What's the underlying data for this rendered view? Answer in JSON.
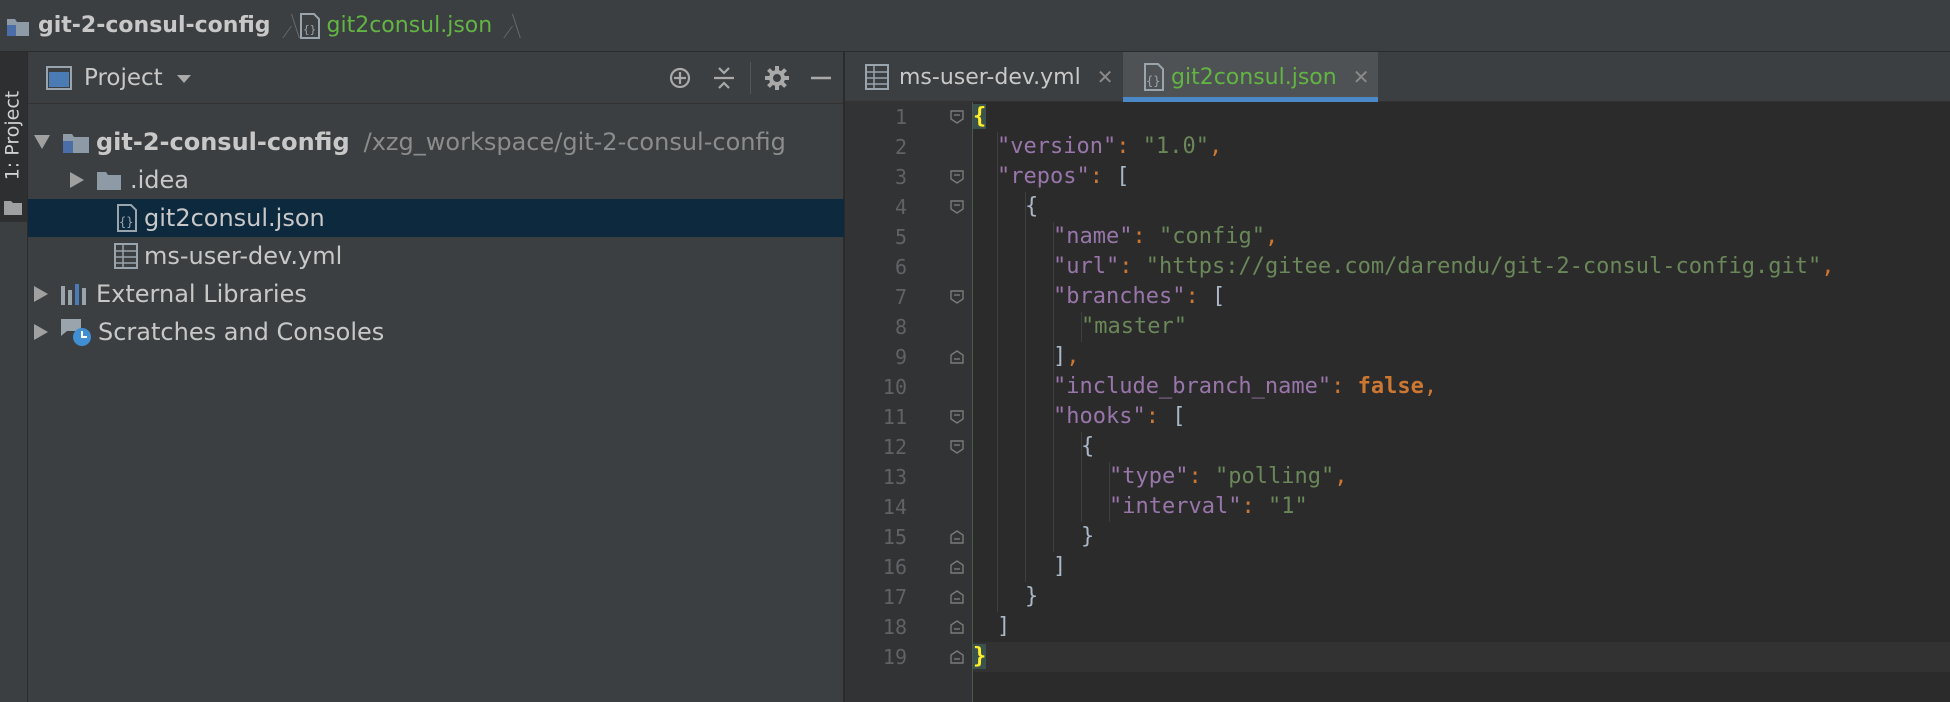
{
  "breadcrumb": {
    "project": "git-2-consul-config",
    "file": "git2consul.json"
  },
  "tool_stripe": {
    "label": "1: Project"
  },
  "project_panel": {
    "title": "Project",
    "tree": [
      {
        "label": "git-2-consul-config",
        "path": "/xzg_workspace/git-2-consul-config",
        "expanded": true
      },
      {
        "label": ".idea",
        "expanded": false
      },
      {
        "label": "git2consul.json",
        "selected": true
      },
      {
        "label": "ms-user-dev.yml"
      },
      {
        "label": "External Libraries",
        "expanded": false
      },
      {
        "label": "Scratches and Consoles",
        "expanded": false
      }
    ]
  },
  "tabs": [
    {
      "label": "ms-user-dev.yml",
      "active": false
    },
    {
      "label": "git2consul.json",
      "active": true
    }
  ],
  "line_numbers": [
    "1",
    "2",
    "3",
    "4",
    "5",
    "6",
    "7",
    "8",
    "9",
    "10",
    "11",
    "12",
    "13",
    "14",
    "15",
    "16",
    "17",
    "18",
    "19"
  ],
  "code": {
    "l2": {
      "key": "\"version\"",
      "value": "\"1.0\""
    },
    "l3": {
      "key": "\"repos\""
    },
    "l5": {
      "key": "\"name\"",
      "value": "\"config\""
    },
    "l6": {
      "key": "\"url\"",
      "value": "\"https://gitee.com/darendu/git-2-consul-config.git\""
    },
    "l7": {
      "key": "\"branches\""
    },
    "l8": {
      "value": "\"master\""
    },
    "l10": {
      "key": "\"include_branch_name\"",
      "value": "false"
    },
    "l11": {
      "key": "\"hooks\""
    },
    "l13": {
      "key": "\"type\"",
      "value": "\"polling\""
    },
    "l14": {
      "key": "\"interval\"",
      "value": "\"1\""
    }
  },
  "colors": {
    "key": "#9876aa",
    "string": "#6a8759",
    "keyword": "#cc7832",
    "accent": "#4a88c7",
    "selection": "#0d293e",
    "active_tab_text": "#62b543"
  }
}
